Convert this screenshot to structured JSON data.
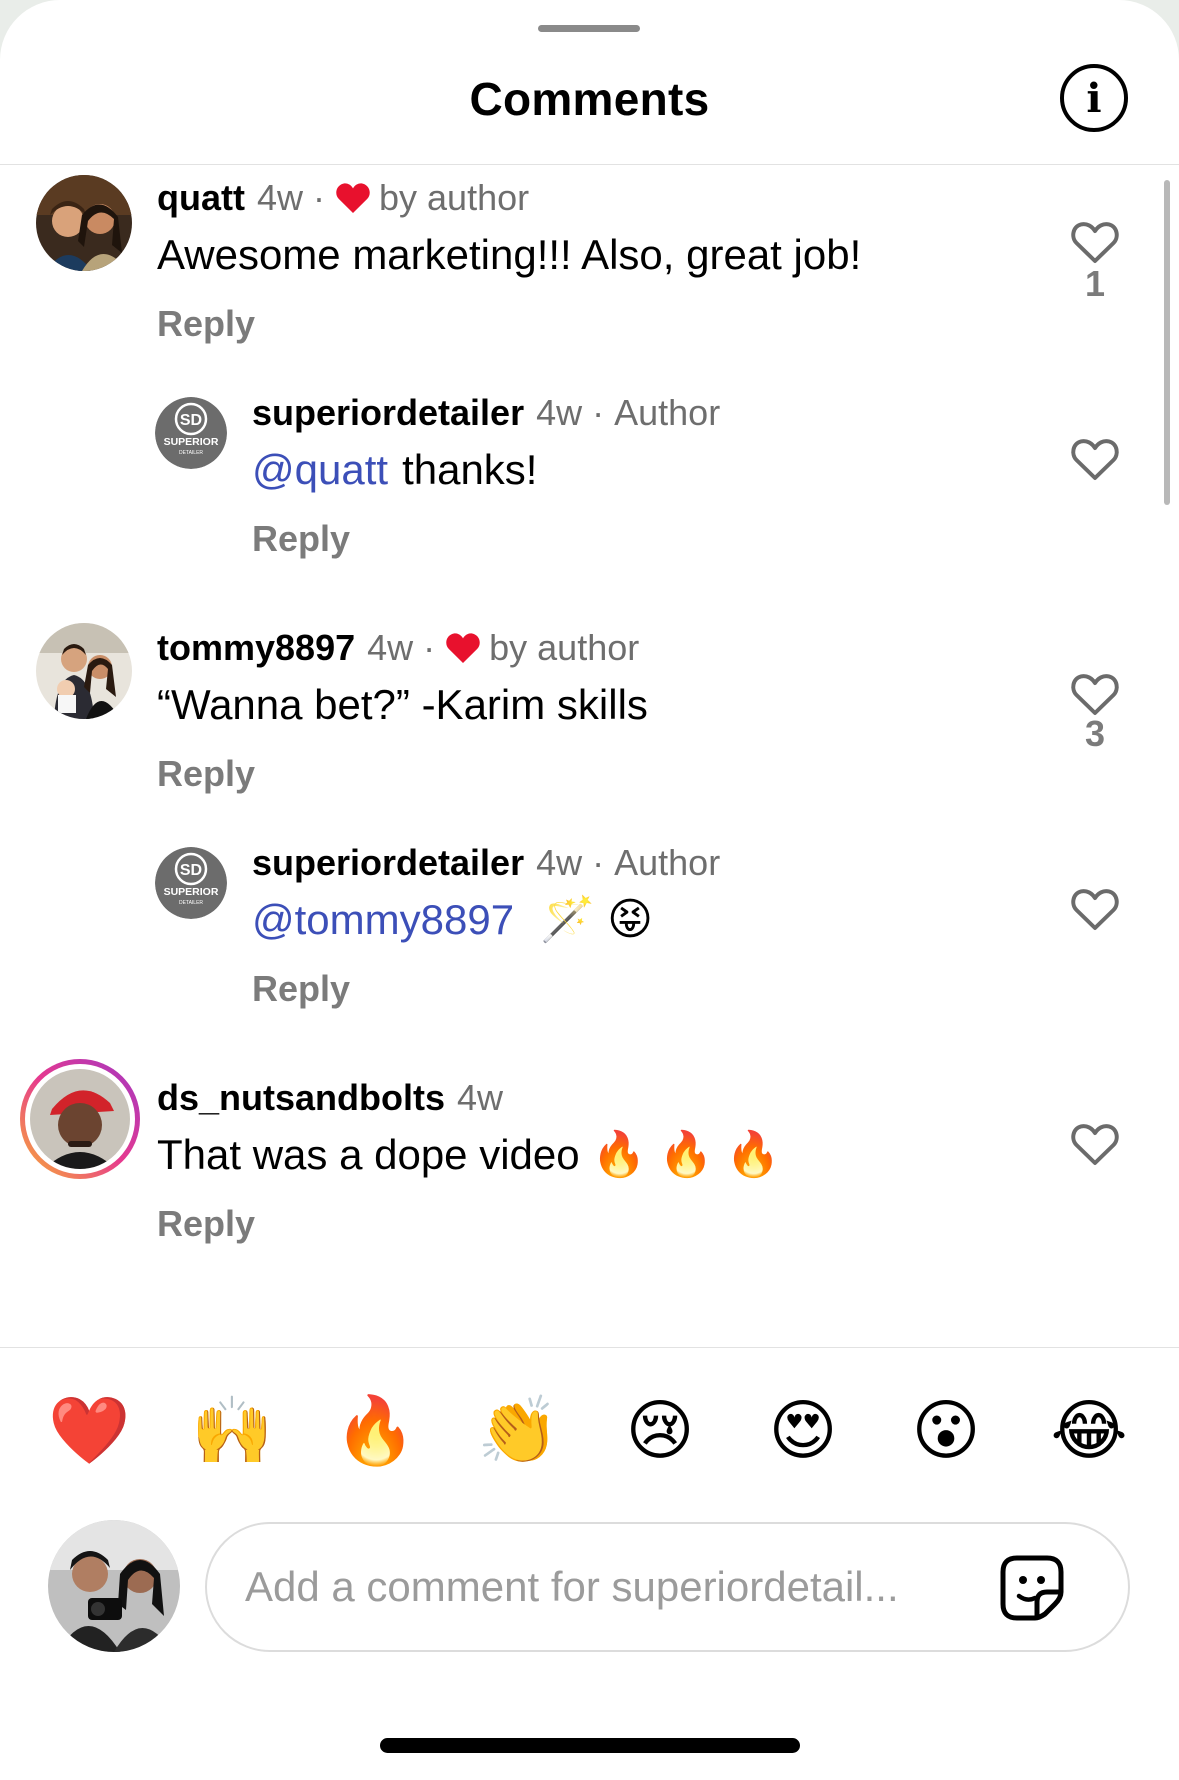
{
  "header": {
    "title": "Comments"
  },
  "comments": [
    {
      "username": "quatt",
      "time": "4w",
      "liked_label": "by author",
      "mention": "",
      "text": "Awesome marketing!!! Also, great job!",
      "emoji": "",
      "reply": "Reply",
      "likes": "1"
    },
    {
      "username": "superiordetailer",
      "time": "4w",
      "role": "Author",
      "mention": "@quatt",
      "text": "thanks!",
      "emoji": "",
      "reply": "Reply",
      "likes": ""
    },
    {
      "username": "tommy8897",
      "time": "4w",
      "liked_label": "by author",
      "mention": "",
      "text": "“Wanna bet?” -Karim skills",
      "emoji": "",
      "reply": "Reply",
      "likes": "3"
    },
    {
      "username": "superiordetailer",
      "time": "4w",
      "role": "Author",
      "mention": "@tommy8897",
      "text": "",
      "emoji": "🪄 😝",
      "reply": "Reply",
      "likes": ""
    },
    {
      "username": "ds_nutsandbolts",
      "time": "4w",
      "mention": "",
      "text": "That was a dope video",
      "emoji": "🔥 🔥 🔥",
      "reply": "Reply",
      "likes": ""
    }
  ],
  "separator": "·",
  "badge": {
    "logo_text": "SD",
    "brand_text": "SUPERIOR",
    "sub_text": "DETAILER"
  },
  "reactions": [
    "❤️",
    "🙌",
    "🔥",
    "👏",
    "😢",
    "😍",
    "😮",
    "😂"
  ],
  "composer": {
    "placeholder": "Add a comment for superiordetail..."
  },
  "colors": {
    "accent_mention": "#3c4fb8",
    "heart_red": "#e8112d",
    "secondary_text": "#6e6e6e"
  },
  "icons": {
    "info": "info-icon",
    "like": "heart-outline-icon",
    "liked_by_author": "red-heart-icon",
    "sticker": "sticker-icon"
  }
}
